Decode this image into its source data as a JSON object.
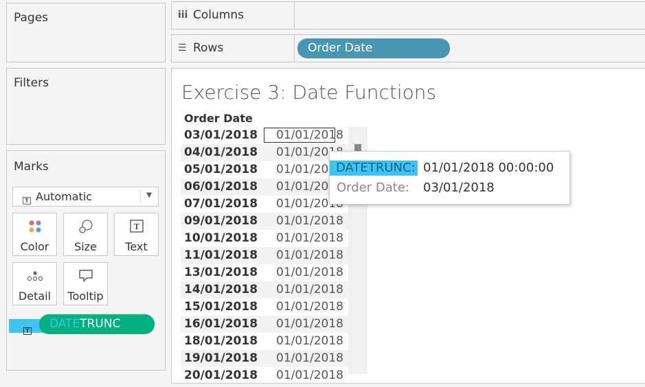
{
  "sidebar": {
    "pages_title": "Pages",
    "filters_title": "Filters",
    "marks_title": "Marks",
    "mark_type": "Automatic",
    "mark_cards": [
      {
        "label": "Color"
      },
      {
        "label": "Size"
      },
      {
        "label": "Text"
      },
      {
        "label": "Detail"
      },
      {
        "label": "Tooltip"
      }
    ],
    "marks_pill": {
      "label_highlight": "DATE",
      "label_rest": "TRUNC"
    }
  },
  "shelves": {
    "columns_label": "Columns",
    "rows_label": "Rows",
    "rows_pill": "Order Date"
  },
  "view": {
    "title": "Exercise 3: Date Functions",
    "column_header": "Order Date",
    "rows": [
      {
        "order_date": "03/01/2018",
        "datetrunc": "01/01/2018"
      },
      {
        "order_date": "04/01/2018",
        "datetrunc": "01/01/2018"
      },
      {
        "order_date": "05/01/2018",
        "datetrunc": "01/01/2018"
      },
      {
        "order_date": "06/01/2018",
        "datetrunc": "01/01/2018"
      },
      {
        "order_date": "07/01/2018",
        "datetrunc": "01/01/2018"
      },
      {
        "order_date": "09/01/2018",
        "datetrunc": "01/01/2018"
      },
      {
        "order_date": "10/01/2018",
        "datetrunc": "01/01/2018"
      },
      {
        "order_date": "11/01/2018",
        "datetrunc": "01/01/2018"
      },
      {
        "order_date": "13/01/2018",
        "datetrunc": "01/01/2018"
      },
      {
        "order_date": "14/01/2018",
        "datetrunc": "01/01/2018"
      },
      {
        "order_date": "15/01/2018",
        "datetrunc": "01/01/2018"
      },
      {
        "order_date": "16/01/2018",
        "datetrunc": "01/01/2018"
      },
      {
        "order_date": "18/01/2018",
        "datetrunc": "01/01/2018"
      },
      {
        "order_date": "19/01/2018",
        "datetrunc": "01/01/2018"
      },
      {
        "order_date": "20/01/2018",
        "datetrunc": "01/01/2018"
      }
    ]
  },
  "tooltip": {
    "label1": "DATETRUNC:",
    "value1": "01/01/2018 00:00:00",
    "label2": "Order Date:",
    "value2": "03/01/2018"
  },
  "colors": {
    "pill_blue": "#4996b2",
    "pill_green": "#00b180",
    "highlight_cyan": "#3cc5f2"
  }
}
